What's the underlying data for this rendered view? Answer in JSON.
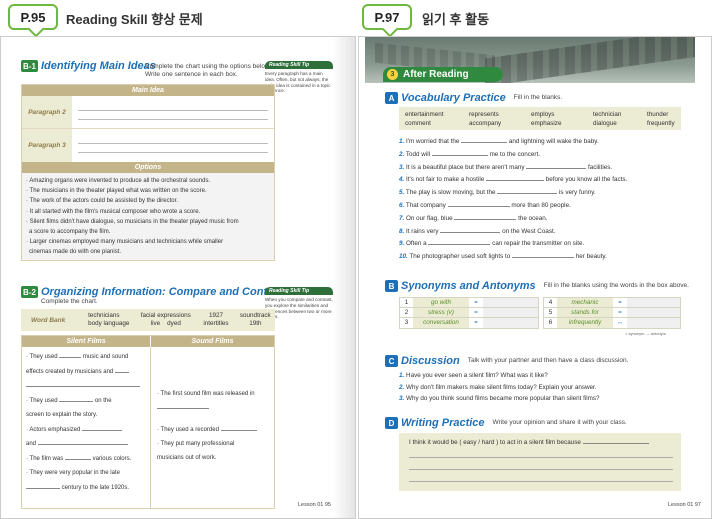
{
  "left_page": {
    "tab": "P.95",
    "title": "Reading Skill 향상 문제",
    "b1": {
      "badge": "B-1",
      "title": "Identifying Main Ideas",
      "instruction": "Complete the chart using the options below. Write one sentence in each box.",
      "tip_title": "Reading Skill Tip",
      "tip_text": "Every paragraph has a main idea. Often, but not always, the main idea is contained in a topic sentence.",
      "header": "Main Idea",
      "rows": [
        "Paragraph 2",
        "Paragraph 3"
      ],
      "options_header": "Options",
      "options": [
        "· Amazing organs were invented to produce all the orchestral sounds.",
        "· The musicians in the theater played what was written on the score.",
        "· The work of the actors could be assisted by the director.",
        "· It all started with the film's musical composer who wrote a score.",
        "· Silent films didn't have dialogue, so musicians in the theater played music from",
        "  a score to accompany the film.",
        "· Larger cinemas employed many musicians and technicians while smaller",
        "  cinemas made do with one pianist."
      ]
    },
    "b2": {
      "badge": "B-2",
      "title": "Organizing Information: Compare and Contrast",
      "instruction": "Complete the chart.",
      "tip_title": "Reading Skill Tip",
      "tip_text": "When you compare and contrast, you explore the similarities and differences between two or more things.",
      "word_bank_label": "Word Bank",
      "word_bank": [
        [
          "technicians",
          "body language"
        ],
        [
          "facial expressions",
          "live",
          "dyed"
        ],
        [
          "1927",
          "intertitles"
        ],
        [
          "soundtrack",
          "19th"
        ]
      ],
      "col_silent": "Silent Films",
      "col_sound": "Sound Films",
      "silent": [
        {
          "pre": "· They used",
          "mid": "music and sound",
          "post": ""
        },
        {
          "pre": "effects created by musicians and",
          "mid": "",
          "post": ""
        },
        {
          "pre": "· They used",
          "mid": "on the",
          "post": ""
        },
        {
          "pre": "screen to explain the story.",
          "mid": "",
          "post": ""
        },
        {
          "pre": "· Actors emphasized",
          "mid": "",
          "post": ""
        },
        {
          "pre": "and",
          "mid": "",
          "post": ""
        },
        {
          "pre": "· The film was",
          "mid": "various colors.",
          "post": ""
        },
        {
          "pre": "· They were very popular in the late",
          "mid": "",
          "post": ""
        },
        {
          "pre": "",
          "mid": "century to the late 1920s.",
          "post": ""
        }
      ],
      "sound": [
        "· The first sound film was released in",
        "· They used a recorded",
        "· They put many professional",
        "musicians out of work."
      ]
    },
    "footer": "Lesson 01   95"
  },
  "right_page": {
    "tab": "P.97",
    "title": "읽기 후 활동",
    "banner_num": "3",
    "banner_text": "After Reading",
    "a": {
      "badge": "A",
      "title": "Vocabulary Practice",
      "instruction": "Fill in the blanks.",
      "words": [
        [
          "entertainment",
          "represents",
          "employs",
          "technician",
          "thunder"
        ],
        [
          "comment",
          "accompany",
          "emphasize",
          "dialogue",
          "frequently"
        ]
      ],
      "sentences": [
        {
          "n": "1.",
          "a": "I'm worried that the",
          "b": "and lightning will wake the baby."
        },
        {
          "n": "2.",
          "a": "Todd will",
          "b": "me to the concert."
        },
        {
          "n": "3.",
          "a": "It is a beautiful place but there aren't many",
          "b": "facilities."
        },
        {
          "n": "4.",
          "a": "It's not fair to make a hostile",
          "b": "before you know all the facts."
        },
        {
          "n": "5.",
          "a": "The play is slow moving, but the",
          "b": "is very funny."
        },
        {
          "n": "6.",
          "a": "That company",
          "b": "more than 80 people."
        },
        {
          "n": "7.",
          "a": "On our flag, blue",
          "b": "the ocean."
        },
        {
          "n": "8.",
          "a": "It rains very",
          "b": "on the West Coast."
        },
        {
          "n": "9.",
          "a": "Often a",
          "b": "can repair the transmitter on site."
        },
        {
          "n": "10.",
          "a": "The photographer used soft lights to",
          "b": "her beauty."
        }
      ]
    },
    "b": {
      "badge": "B",
      "title": "Synonyms and Antonyms",
      "instruction": "Fill in the blanks using the words in the box above.",
      "left": [
        {
          "n": "1",
          "w": "go with",
          "s": "="
        },
        {
          "n": "2",
          "w": "stress (v)",
          "s": "="
        },
        {
          "n": "3",
          "w": "conversation",
          "s": "="
        }
      ],
      "right": [
        {
          "n": "4",
          "w": "mechanic",
          "s": "="
        },
        {
          "n": "5",
          "w": "stands for",
          "s": "="
        },
        {
          "n": "6",
          "w": "infrequently",
          "s": "↔"
        }
      ],
      "legend": "= synonym   ↔ antonym"
    },
    "c": {
      "badge": "C",
      "title": "Discussion",
      "instruction": "Talk with your partner and then have a class discussion.",
      "questions": [
        {
          "n": "1.",
          "t": "Have you ever seen a silent film? What was it like?"
        },
        {
          "n": "2.",
          "t": "Why don't film makers make silent films today? Explain your answer."
        },
        {
          "n": "3.",
          "t": "Why do you think sound films became more popular than silent films?"
        }
      ]
    },
    "d": {
      "badge": "D",
      "title": "Writing Practice",
      "instruction": "Write your opinion and share it with your class.",
      "prompt": "I think it would be ( easy / hard ) to act in a silent film because"
    },
    "footer": "Lesson 01   97"
  }
}
